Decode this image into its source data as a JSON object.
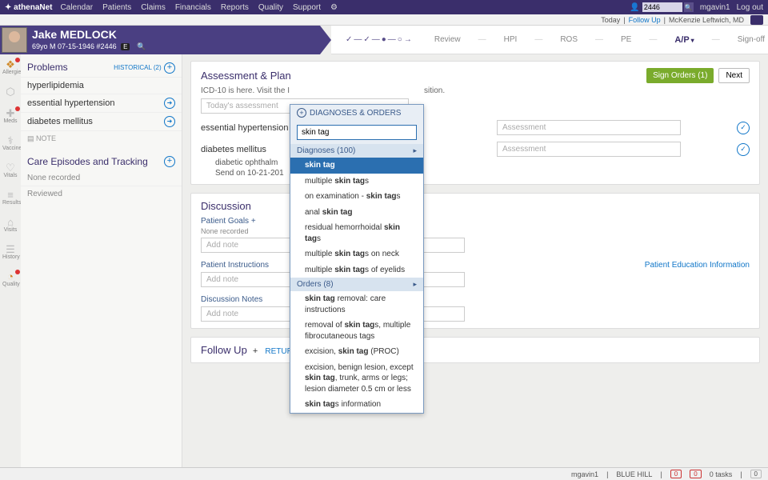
{
  "topnav": {
    "brand": "athenaNet",
    "items": [
      "Calendar",
      "Patients",
      "Claims",
      "Financials",
      "Reports",
      "Quality",
      "Support"
    ],
    "search_value": "2446",
    "user": "mgavin1",
    "logout": "Log out"
  },
  "subnav": {
    "today": "Today",
    "followup": "Follow Up",
    "provider": "McKenzie Leftwich, MD"
  },
  "patient": {
    "name": "Jake MEDLOCK",
    "meta": "69yo M   07-15-1946   #2446",
    "badge": "E"
  },
  "workflow": {
    "dots": "✓—✓—●—○→",
    "steps": [
      "Review",
      "HPI",
      "ROS",
      "PE",
      "A/P",
      "Sign-off"
    ],
    "active_index": 4
  },
  "iconrail": [
    {
      "icon": "❖",
      "label": "Allergies",
      "warn": true,
      "dot": true
    },
    {
      "icon": "⬡",
      "label": ""
    },
    {
      "icon": "✚",
      "label": "Meds",
      "dot": true
    },
    {
      "icon": "⚕",
      "label": "Vaccines"
    },
    {
      "icon": "♡",
      "label": "Vitals"
    },
    {
      "icon": "≡",
      "label": "Results"
    },
    {
      "icon": "⌂",
      "label": "Visits"
    },
    {
      "icon": "☰",
      "label": "History"
    },
    {
      "icon": "◔",
      "label": "Quality",
      "warn": true,
      "dot": true
    }
  ],
  "problems": {
    "title": "Problems",
    "historical": "HISTORICAL (2)",
    "items": [
      "hyperlipidemia",
      "essential hypertension",
      "diabetes mellitus"
    ],
    "note": "▤ NOTE"
  },
  "care": {
    "title": "Care Episodes and Tracking",
    "none": "None recorded",
    "reviewed": "Reviewed"
  },
  "assessment": {
    "title": "Assessment & Plan",
    "sign_btn": "Sign Orders (1)",
    "next_btn": "Next",
    "icd_line_a": "ICD-10 is here. Visit the I",
    "icd_line_b": "sition.",
    "todays_placeholder": "Today's assessment",
    "dx": [
      {
        "name": "essential hypertension"
      },
      {
        "name": "diabetes mellitus",
        "sub1": "diabetic ophthalm",
        "sub2": "Send on 10-21-201"
      }
    ],
    "assess_placeholder": "Assessment"
  },
  "discussion": {
    "title": "Discussion",
    "goals_lbl": "Patient Goals",
    "none": "None recorded",
    "addnote": "Add note",
    "instr_lbl": "Patient Instructions",
    "ptedu": "Patient Education Information",
    "notes_lbl": "Discussion Notes"
  },
  "followup": {
    "title": "Follow Up",
    "rto": "RETURN TO OFFICE"
  },
  "popup": {
    "header": "DIAGNOSES & ORDERS",
    "query": "skin tag",
    "diag_hdr": "Diagnoses (100)",
    "diag_opts": [
      {
        "pre": "",
        "match": "skin tag",
        "post": "",
        "sel": true
      },
      {
        "pre": "multiple ",
        "match": "skin tag",
        "post": "s"
      },
      {
        "pre": "on examination - ",
        "match": "skin tag",
        "post": "s"
      },
      {
        "pre": "anal ",
        "match": "skin tag",
        "post": ""
      },
      {
        "pre": "residual hemorrhoidal ",
        "match": "skin tag",
        "post": "s"
      },
      {
        "pre": "multiple ",
        "match": "skin tag",
        "post": "s on neck"
      },
      {
        "pre": "multiple ",
        "match": "skin tag",
        "post": "s of eyelids"
      }
    ],
    "ord_hdr": "Orders (8)",
    "ord_opts": [
      {
        "pre": "",
        "match": "skin tag",
        "post": " removal: care instructions"
      },
      {
        "pre": "removal of ",
        "match": "skin tag",
        "post": "s, multiple fibrocutaneous tags",
        "wrap": true
      },
      {
        "pre": "excision, ",
        "match": "skin tag",
        "post": " (PROC)"
      },
      {
        "pre": "excision, benign lesion, except ",
        "match": "skin tag",
        "post": ", trunk, arms or legs; lesion diameter 0.5 cm or less",
        "wrap": true
      },
      {
        "pre": "",
        "match": "skin tag",
        "post": "s information"
      }
    ]
  },
  "footer": {
    "user": "mgavin1",
    "loc": "BLUE HILL",
    "zero1": "0",
    "zero2": "0",
    "tasks": "0 tasks",
    "inbox": "0"
  }
}
